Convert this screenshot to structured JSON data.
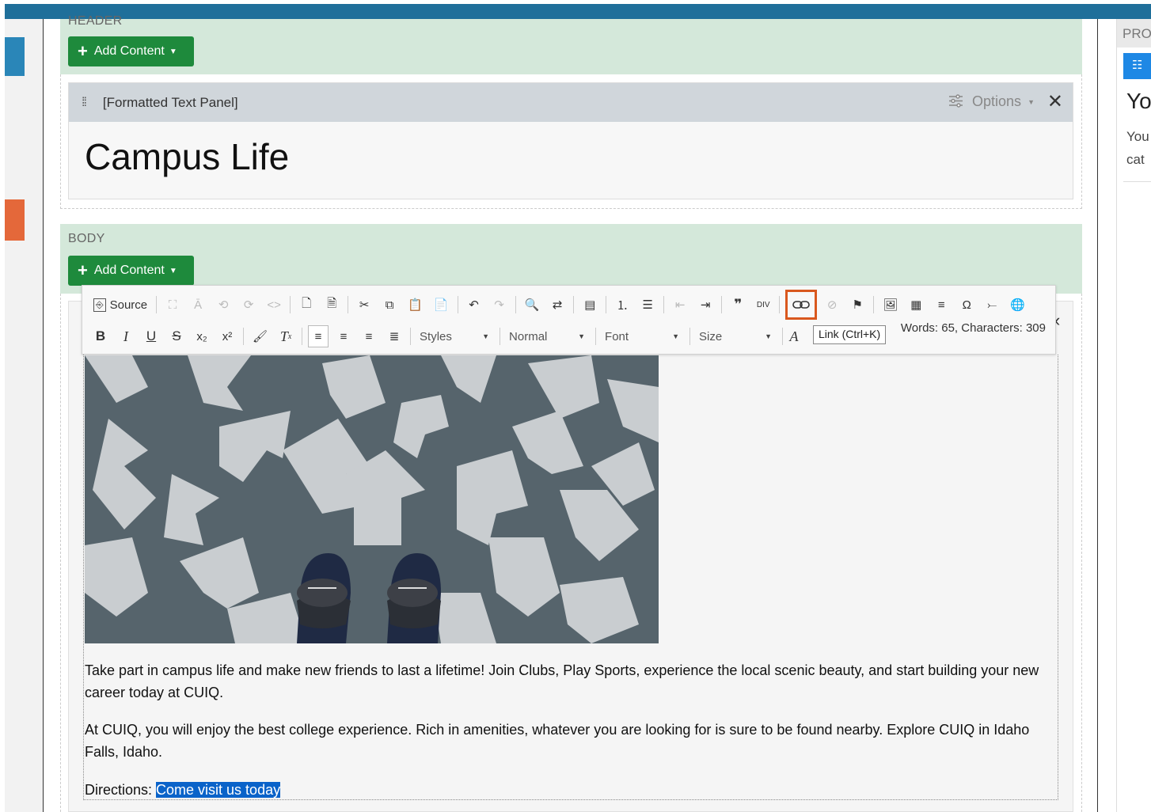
{
  "header_zone": {
    "label": "HEADER",
    "add_content": "Add Content"
  },
  "panel": {
    "name": "[Formatted Text Panel]",
    "options_label": "Options",
    "close_glyph": "✕",
    "heading": "Campus Life"
  },
  "body_zone": {
    "label": "BODY",
    "add_content": "Add Content"
  },
  "toolbar": {
    "source_label": "Source",
    "styles_combo": "Styles",
    "format_combo": "Normal",
    "font_combo": "Font",
    "size_combo": "Size",
    "word_count": "Words: 65, Characters: 309",
    "tooltip": "Link (Ctrl+K)",
    "highlight_color": "#d9581e"
  },
  "content": {
    "paragraph1": "Take part in campus life and make new friends to last a lifetime!  Join Clubs, Play Sports, experience the local scenic beauty, and start building your new career today at CUIQ.",
    "paragraph2": "At CUIQ, you will enjoy the best college experience. Rich in amenities, whatever you are looking for is sure to be found nearby.  Explore CUIQ in Idaho Falls, Idaho.",
    "directions_label": "Directions: ",
    "selected_link_text": "Come visit us today"
  },
  "right_panel": {
    "heading_partial": "PRO",
    "title_partial": "Yo",
    "text_line1": "You",
    "text_line2": "cat"
  },
  "colors": {
    "topbar": "#1f6f9a",
    "zone_bg": "#d4e8da",
    "add_button": "#1e8a3c",
    "accent_blue": "#1e88e5",
    "accent_orange": "#e4683a",
    "selection": "#0a63c9"
  }
}
